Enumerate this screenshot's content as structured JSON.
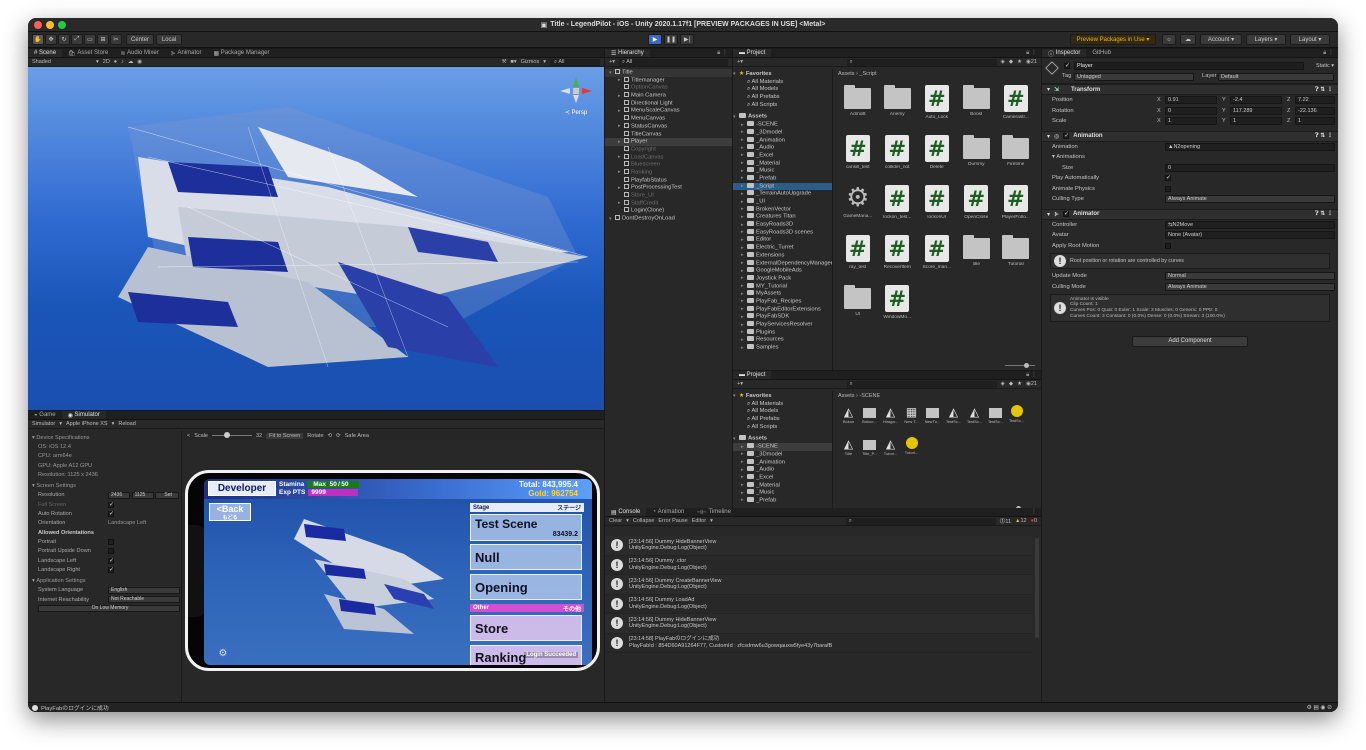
{
  "window": {
    "title": "Title - LegendPilot - iOS - Unity 2020.1.17f1 [PREVIEW PACKAGES IN USE] <Metal>"
  },
  "toolbar": {
    "center": "Center",
    "local": "Local",
    "preview_packages": "Preview Packages in Use",
    "account": "Account",
    "layers": "Layers",
    "layout": "Layout"
  },
  "scene": {
    "tabs": [
      "Scene",
      "Asset Store",
      "Audio Mixer",
      "Animator",
      "Package Manager"
    ],
    "shading": "Shaded",
    "mode2d": "2D",
    "gizmos": "Gizmos",
    "search": "All",
    "persp": "≺ Persp"
  },
  "game": {
    "tabs": [
      "Game",
      "Simulator"
    ],
    "simulator": "Simulator",
    "device": "Apple iPhone XS",
    "reload": "Reload",
    "scale_label": "Scale",
    "scale_val": "32",
    "fit": "Fit to Screen",
    "rotate": "Rotate",
    "safe": "Safe Area",
    "device_spec": "Device Specifications",
    "os": "OS: iOS 12.4",
    "cpu": "CPU: arm64e",
    "gpu": "GPU: Apple A12 GPU",
    "resolution_text": "Resolution: 1125 x 2436",
    "screen_settings": "Screen Settings",
    "res_label": "Resolution",
    "res_w": "2436",
    "res_h": "1125",
    "set": "Set",
    "fullscreen": "Full Screen",
    "autorot": "Auto Rotation",
    "orientation_label": "Orientation",
    "orientation": "Landscape Left",
    "allowed": "Allowed Orientations",
    "portrait": "Portrait",
    "portrait_ud": "Portrait Upside Down",
    "land_left": "Landscape Left",
    "land_right": "Landscape Right",
    "app_settings": "Application Settings",
    "sys_lang_label": "System Language",
    "sys_lang": "English",
    "internet_label": "Internet Reachability",
    "internet": "Not Reachable",
    "low_mem": "On Low Memory"
  },
  "phone": {
    "developer": "Developer",
    "stamina": "Stamina",
    "max": "Max",
    "stamina_val": "50 / 50",
    "exp": "Exp PTS",
    "exp_val": "9999",
    "total": "Total: 843,995.4",
    "gold": "Gold: 962754",
    "back": "<Back",
    "back_jp": "もどる",
    "stage": "Stage",
    "stage_jp": "ステージ",
    "test_scene": "Test Scene",
    "test_score": "83439.2",
    "null": "Null",
    "opening": "Opening",
    "other": "Other",
    "other_jp": "その他",
    "store": "Store",
    "ranking": "Ranking",
    "login": "Login Succeeded"
  },
  "hierarchy": {
    "tab": "Hierarchy",
    "search": "All",
    "items": [
      {
        "label": "Title",
        "depth": 0,
        "type": "scene"
      },
      {
        "label": "Titlemanager",
        "depth": 1,
        "type": "obj"
      },
      {
        "label": "OptionCanvas",
        "depth": 1,
        "type": "dim"
      },
      {
        "label": "Main Camera",
        "depth": 1,
        "type": "obj"
      },
      {
        "label": "Directional Light",
        "depth": 1,
        "type": "obj"
      },
      {
        "label": "MenuScaleCanvas",
        "depth": 1,
        "type": "obj"
      },
      {
        "label": "MenuCanvas",
        "depth": 1,
        "type": "obj"
      },
      {
        "label": "StatusCanvas",
        "depth": 1,
        "type": "obj"
      },
      {
        "label": "TitleCanvas",
        "depth": 1,
        "type": "obj"
      },
      {
        "label": "Player",
        "depth": 1,
        "type": "sel"
      },
      {
        "label": "Copyright",
        "depth": 1,
        "type": "dim"
      },
      {
        "label": "LoadCanvas",
        "depth": 1,
        "type": "dim"
      },
      {
        "label": "Bluescreen",
        "depth": 1,
        "type": "dim"
      },
      {
        "label": "Ranking",
        "depth": 1,
        "type": "dim"
      },
      {
        "label": "PlayfabStatus",
        "depth": 1,
        "type": "obj"
      },
      {
        "label": "PostProcessingTest",
        "depth": 1,
        "type": "obj"
      },
      {
        "label": "Store_UI",
        "depth": 1,
        "type": "dim"
      },
      {
        "label": "StaffCredit",
        "depth": 1,
        "type": "dim"
      },
      {
        "label": "Login(Clone)",
        "depth": 1,
        "type": "obj"
      },
      {
        "label": "DontDestroyOnLoad",
        "depth": 0,
        "type": "scene"
      }
    ]
  },
  "project": {
    "tab": "Project",
    "count": "21",
    "path": "Assets › _Script",
    "favorites": "Favorites",
    "fav_items": [
      "All Materials",
      "All Models",
      "All Prefabs",
      "All Scripts"
    ],
    "assets": "Assets",
    "tree": [
      "-SCENE",
      "_3Dmodel",
      "_Animation",
      "_Audio",
      "_Excel",
      "_Material",
      "_Music",
      "_Prefab",
      "_Script",
      "_TerrainAutoUpgrade",
      "_UI",
      "BrokenVector",
      "Creatures Titan",
      "EasyRoads3D",
      "EasyRoads3D scenes",
      "Editor",
      "Electric_Turret",
      "Extensions",
      "ExternalDependencyManager",
      "GoogleMobileAds",
      "Joystick Pack",
      "MY_Tutorial",
      "MyAssets",
      "PlayFab_Recipes",
      "PlayFabEditorExtensions",
      "PlayFabSDK",
      "PlayServicesResolver",
      "Plugins",
      "Resources",
      "Samples"
    ],
    "grid": [
      {
        "label": "AdmoB",
        "kind": "folder"
      },
      {
        "label": "Anemy",
        "kind": "folder"
      },
      {
        "label": "Auto_Lock",
        "kind": "script"
      },
      {
        "label": "Boost",
        "kind": "folder"
      },
      {
        "label": "Camerastr...",
        "kind": "script"
      },
      {
        "label": "cansill_test",
        "kind": "script"
      },
      {
        "label": "collider_not",
        "kind": "script"
      },
      {
        "label": "Delete",
        "kind": "script"
      },
      {
        "label": "Dummy",
        "kind": "folder"
      },
      {
        "label": "Firetime",
        "kind": "folder"
      },
      {
        "label": "GameMana...",
        "kind": "gear"
      },
      {
        "label": "lockon_test...",
        "kind": "script"
      },
      {
        "label": "lockonUI",
        "kind": "script"
      },
      {
        "label": "OpenClose",
        "kind": "script"
      },
      {
        "label": "PlayerFollo...",
        "kind": "script"
      },
      {
        "label": "ray_test",
        "kind": "script"
      },
      {
        "label": "RecoverItem",
        "kind": "script"
      },
      {
        "label": "Score_man...",
        "kind": "script"
      },
      {
        "label": "title",
        "kind": "folder"
      },
      {
        "label": "Tutorial",
        "kind": "folder"
      },
      {
        "label": "UI",
        "kind": "folder"
      },
      {
        "label": "WindowMo...",
        "kind": "script"
      }
    ]
  },
  "project2": {
    "tab": "Project",
    "count": "21",
    "path": "Assets › -SCENE",
    "tree": [
      "-SCENE",
      "_3Dmodel",
      "_Animation",
      "_Audio",
      "_Excel",
      "_Material",
      "_Music",
      "_Prefab"
    ],
    "grid": [
      {
        "label": "Bokoo",
        "kind": "unity"
      },
      {
        "label": "Bokoo...",
        "kind": "folder"
      },
      {
        "label": "Hiraga...",
        "kind": "unity"
      },
      {
        "label": "New T...",
        "kind": "film"
      },
      {
        "label": "NewTu...",
        "kind": "folder"
      },
      {
        "label": "TestSc...",
        "kind": "unity"
      },
      {
        "label": "TestSc...",
        "kind": "unity"
      },
      {
        "label": "TestSc...",
        "kind": "folder"
      },
      {
        "label": "TestSc...",
        "kind": "ball"
      },
      {
        "label": "Title",
        "kind": "unity"
      },
      {
        "label": "Title_P...",
        "kind": "folder"
      },
      {
        "label": "Tutori...",
        "kind": "unity"
      },
      {
        "label": "Tutori...",
        "kind": "ball"
      }
    ]
  },
  "console": {
    "tabs": [
      "Console",
      "Animation",
      "Timeline"
    ],
    "clear": "Clear",
    "collapse": "Collapse",
    "error_pause": "Error Pause",
    "editor": "Editor",
    "counts": [
      "11",
      "12",
      "0"
    ],
    "logs": [
      {
        "l1": "[23:14:56] Dummy HideBannerView",
        "l2": "UnityEngine.Debug:Log(Object)"
      },
      {
        "l1": "[23:14:56] Dummy .ctor",
        "l2": "UnityEngine.Debug:Log(Object)"
      },
      {
        "l1": "[23:14:56] Dummy CreateBannerView",
        "l2": "UnityEngine.Debug:Log(Object)"
      },
      {
        "l1": "[23:14:56] Dummy LoadAd",
        "l2": "UnityEngine.Debug:Log(Object)"
      },
      {
        "l1": "[23:14:56] Dummy HideBannerView",
        "l2": "UnityEngine.Debug:Log(Object)"
      },
      {
        "l1": "[23:14:58] PlayFabのログインに成功",
        "l2": "PlayFabId : 854D60A91264F77, CustomId : zfcsdmw6u3gowqauxw5fye43y7barafB"
      }
    ]
  },
  "inspector": {
    "tabs": [
      "Inspector",
      "GitHub"
    ],
    "name": "Player",
    "static": "Static",
    "tag_label": "Tag",
    "tag": "Untagged",
    "layer_label": "Layer",
    "layer": "Default",
    "transform": "Transform",
    "position": {
      "label": "Position",
      "x": "0.91",
      "y": "-2.4",
      "z": "7.22"
    },
    "rotation": {
      "label": "Rotation",
      "x": "0",
      "y": "117.289",
      "z": "-22.136"
    },
    "scale": {
      "label": "Scale",
      "x": "1",
      "y": "1",
      "z": "1"
    },
    "animation": "Animation",
    "anim_label": "Animation",
    "anim_val": "N2opening",
    "animations_label": "Animations",
    "size_label": "Size",
    "size_val": "0",
    "play_auto": "Play Automatically",
    "anim_physics": "Animate Physics",
    "culling_label": "Culling Type",
    "culling_val": "Always Animate",
    "animator": "Animator",
    "controller_label": "Controller",
    "controller_val": "N2Move",
    "avatar_label": "Avatar",
    "avatar_val": "None (Avatar)",
    "root_motion": "Apply Root Motion",
    "root_info": "Root position or rotation are controlled by curves",
    "update_label": "Update Mode",
    "update_val": "Normal",
    "cull_mode_label": "Culling Mode",
    "cull_mode_val": "Always Animate",
    "anim_info1": "Animator is visible",
    "anim_info2": "Clip Count: 1",
    "anim_info3": "Curves Pos: 0 Quat: 0 Euler: 1 Scale: 3 Muscles: 0 Generic: 0 PPtr: 0",
    "anim_info4": "Curves Count: 3 Constant: 0 (0.0%) Dense: 0 (0.0%) Stream: 3 (100.0%)",
    "add_component": "Add Component"
  },
  "statusbar": {
    "text": "PlayFabのログインに成功"
  }
}
